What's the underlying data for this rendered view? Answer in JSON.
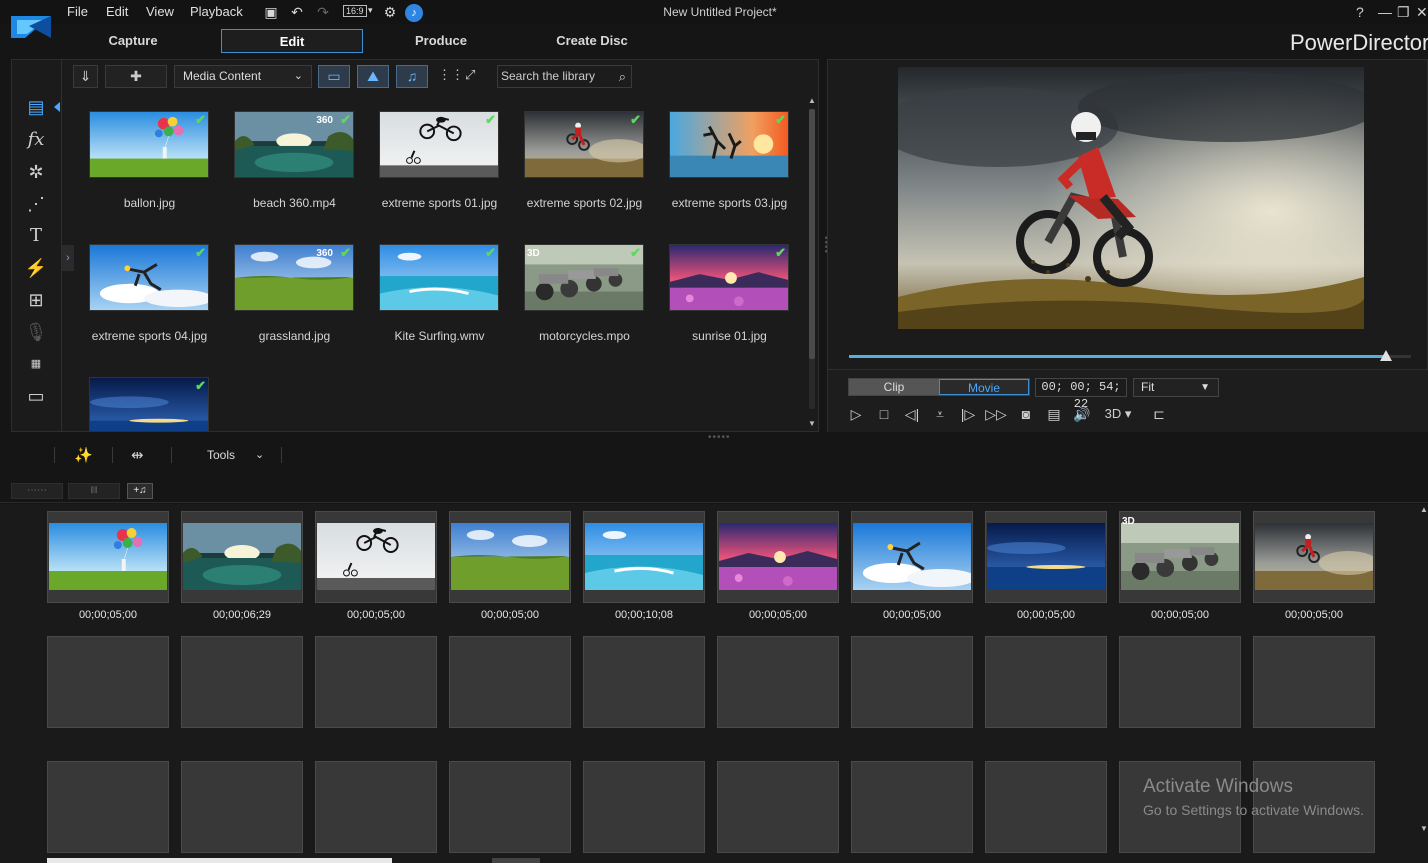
{
  "menu": {
    "file": "File",
    "edit": "Edit",
    "view": "View",
    "playback": "Playback",
    "aspect": "16:9"
  },
  "window": {
    "title": "New Untitled Project*",
    "help": "?",
    "minimize": "—",
    "restore": "❐",
    "close": "✕"
  },
  "modes": {
    "capture": "Capture",
    "edit": "Edit",
    "produce": "Produce",
    "create_disc": "Create Disc"
  },
  "brand": "PowerDirector",
  "library": {
    "dropdown": "Media Content",
    "search_placeholder": "Search the library",
    "items": [
      {
        "name": "ballon.jpg",
        "badge": "",
        "scene": "balloon"
      },
      {
        "name": "beach 360.mp4",
        "badge": "360",
        "scene": "beach"
      },
      {
        "name": "extreme sports 01.jpg",
        "badge": "",
        "scene": "bmx"
      },
      {
        "name": "extreme sports 02.jpg",
        "badge": "",
        "scene": "moto"
      },
      {
        "name": "extreme sports 03.jpg",
        "badge": "",
        "scene": "sunset"
      },
      {
        "name": "extreme sports 04.jpg",
        "badge": "",
        "scene": "sky"
      },
      {
        "name": "grassland.jpg",
        "badge": "360",
        "scene": "grass"
      },
      {
        "name": "Kite Surfing.wmv",
        "badge": "",
        "scene": "kite"
      },
      {
        "name": "motorcycles.mpo",
        "badge": "3D",
        "scene": "bikes"
      },
      {
        "name": "sunrise 01.jpg",
        "badge": "",
        "scene": "sunrise"
      },
      {
        "name": "",
        "badge": "",
        "scene": "night"
      }
    ]
  },
  "preview": {
    "clip_label": "Clip",
    "movie_label": "Movie",
    "timecode": "00; 00; 54; 22",
    "fit": "Fit",
    "three_d": "3D",
    "progress": 0.955
  },
  "tools": {
    "label": "Tools"
  },
  "storyboard": {
    "clips": [
      {
        "duration": "00;00;05;00",
        "scene": "balloon",
        "badge": ""
      },
      {
        "duration": "00;00;06;29",
        "scene": "beach",
        "badge": ""
      },
      {
        "duration": "00;00;05;00",
        "scene": "bmx",
        "badge": ""
      },
      {
        "duration": "00;00;05;00",
        "scene": "grass",
        "badge": ""
      },
      {
        "duration": "00;00;10;08",
        "scene": "kite",
        "badge": ""
      },
      {
        "duration": "00;00;05;00",
        "scene": "sunrise",
        "badge": ""
      },
      {
        "duration": "00;00;05;00",
        "scene": "sky",
        "badge": ""
      },
      {
        "duration": "00;00;05;00",
        "scene": "night",
        "badge": ""
      },
      {
        "duration": "00;00;05;00",
        "scene": "bikes",
        "badge": "3D"
      },
      {
        "duration": "00;00;05;00",
        "scene": "moto",
        "badge": ""
      }
    ]
  },
  "watermark": {
    "title": "Activate Windows",
    "subtitle": "Go to Settings to activate Windows."
  }
}
